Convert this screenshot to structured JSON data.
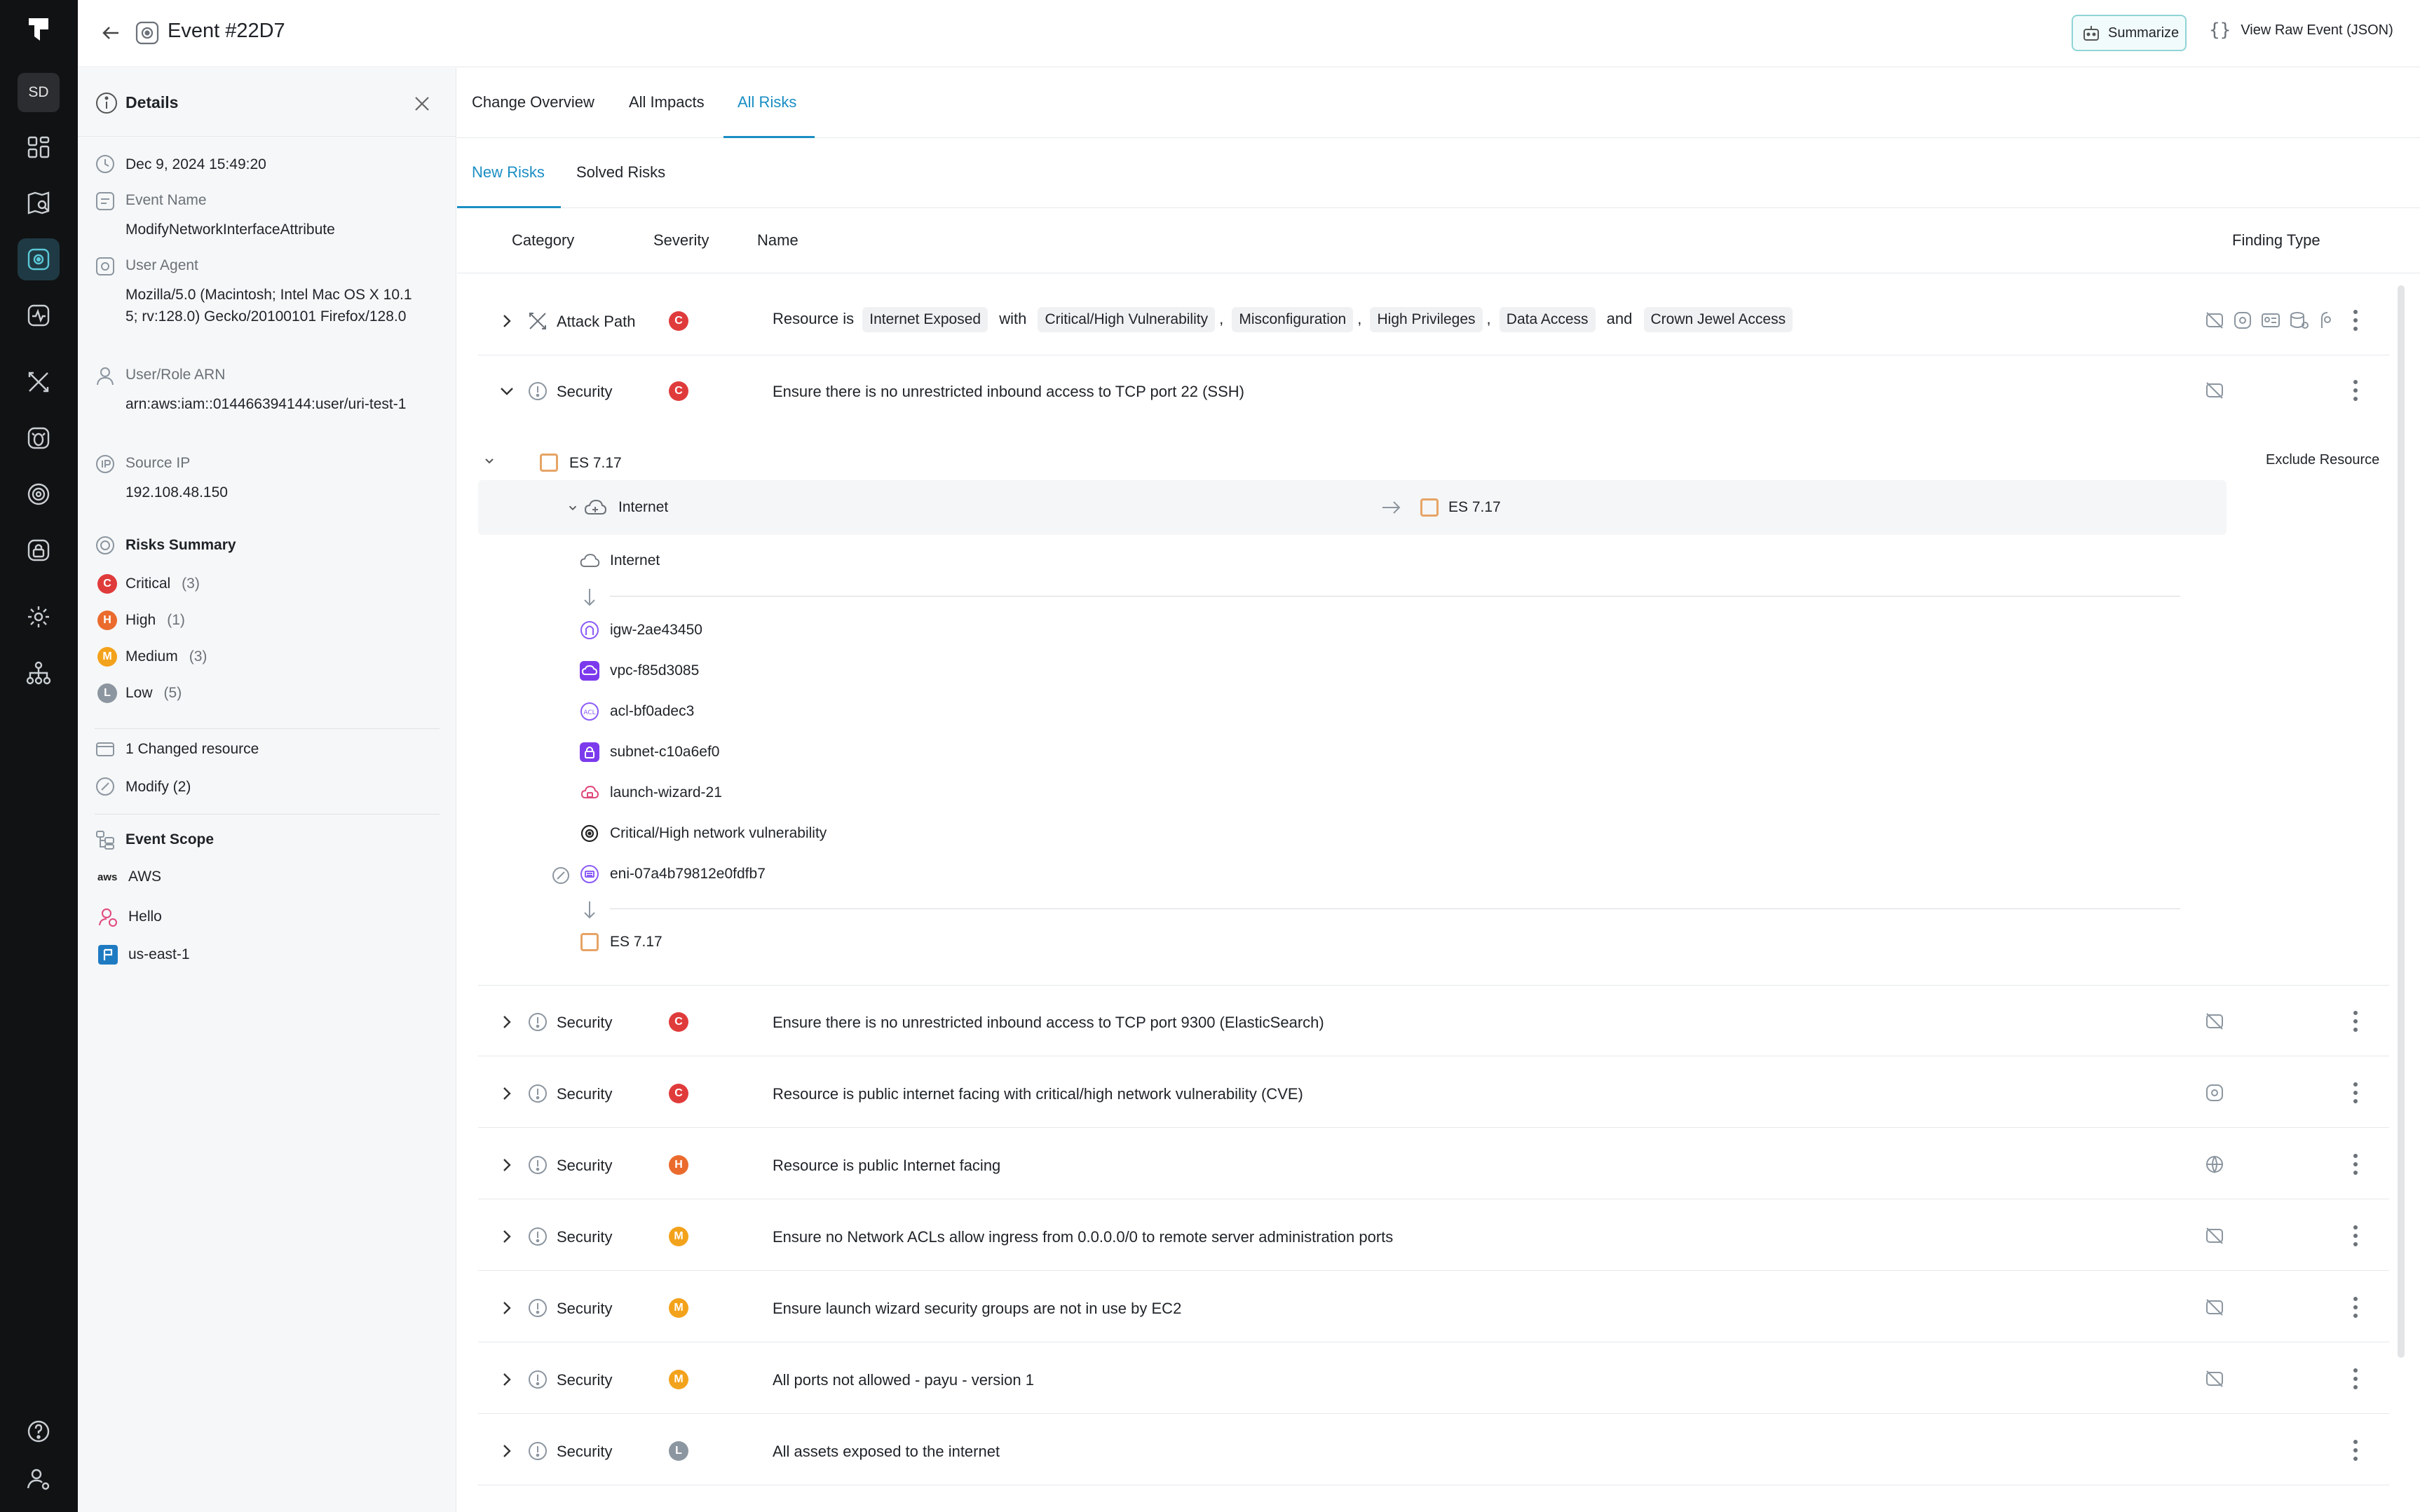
{
  "header": {
    "title": "Event #22D7",
    "summarize_label": "Summarize",
    "raw_label": "View Raw Event (JSON)"
  },
  "rail": {
    "avatar": "SD"
  },
  "details": {
    "title": "Details",
    "timestamp": "Dec 9, 2024 15:49:20",
    "event_name_label": "Event Name",
    "event_name": "ModifyNetworkInterfaceAttribute",
    "user_agent_label": "User Agent",
    "user_agent": "Mozilla/5.0 (Macintosh; Intel Mac OS X 10.15; rv:128.0) Gecko/20100101 Firefox/128.0",
    "arn_label": "User/Role ARN",
    "arn": "arn:aws:iam::014466394144:user/uri-test-1",
    "source_ip_label": "Source IP",
    "source_ip": "192.108.48.150",
    "risks_summary_label": "Risks Summary",
    "risks": [
      {
        "letter": "C",
        "label": "Critical",
        "count": "(3)",
        "color": "#e03b3b"
      },
      {
        "letter": "H",
        "label": "High",
        "count": "(1)",
        "color": "#ea6b2d"
      },
      {
        "letter": "M",
        "label": "Medium",
        "count": "(3)",
        "color": "#f3a21b"
      },
      {
        "letter": "L",
        "label": "Low",
        "count": "(5)",
        "color": "#8c96a0"
      }
    ],
    "changed_label": "1 Changed resource",
    "modify_label": "Modify (2)",
    "scope_label": "Event Scope",
    "scope": {
      "aws": "AWS",
      "aws_logo": "aws",
      "account": "Hello",
      "region": "us-east-1"
    }
  },
  "tabs": {
    "primary": [
      "Change Overview",
      "All Impacts",
      "All Risks"
    ],
    "primary_active": "All Risks",
    "secondary": [
      "New Risks",
      "Solved Risks"
    ],
    "secondary_active": "New Risks"
  },
  "table": {
    "columns": {
      "category": "Category",
      "severity": "Severity",
      "name": "Name",
      "finding": "Finding Type"
    },
    "attack_row": {
      "category": "Attack Path",
      "severity": "C",
      "prefix": "Resource is",
      "chip1": "Internet Exposed",
      "with": "with",
      "chip2": "Critical/High Vulnerability",
      "comma1": ",",
      "chip3": "Misconfiguration",
      "comma2": ",",
      "chip4": "High Privileges",
      "comma3": ",",
      "chip5": "Data Access",
      "and": "and",
      "chip6": "Crown Jewel Access"
    },
    "rows": [
      {
        "category": "Security",
        "severity": "C",
        "name": "Ensure there is no unrestricted inbound access to TCP port 22 (SSH)"
      },
      {
        "category": "Security",
        "severity": "C",
        "name": "Ensure there is no unrestricted inbound access to TCP port 9300 (ElasticSearch)"
      },
      {
        "category": "Security",
        "severity": "C",
        "name": "Resource is public internet facing with critical/high network vulnerability (CVE)"
      },
      {
        "category": "Security",
        "severity": "H",
        "name": "Resource is public Internet facing"
      },
      {
        "category": "Security",
        "severity": "M",
        "name": "Ensure no Network ACLs allow ingress from 0.0.0.0/0 to remote server administration ports"
      },
      {
        "category": "Security",
        "severity": "M",
        "name": "Ensure launch wizard security groups are not in use by EC2"
      },
      {
        "category": "Security",
        "severity": "M",
        "name": "All ports not allowed - payu - version 1"
      },
      {
        "category": "Security",
        "severity": "L",
        "name": "All assets exposed to the internet"
      }
    ],
    "expanded": {
      "resource": "ES 7.17",
      "exclude_label": "Exclude Resource",
      "path_source": "Internet",
      "path_target": "ES 7.17",
      "nodes": [
        {
          "label": "Internet"
        },
        {
          "label": "igw-2ae43450"
        },
        {
          "label": "vpc-f85d3085"
        },
        {
          "label": "acl-bf0adec3"
        },
        {
          "label": "subnet-c10a6ef0"
        },
        {
          "label": "launch-wizard-21"
        },
        {
          "label": "Critical/High network vulnerability"
        },
        {
          "label": "eni-07a4b79812e0fdfb7"
        },
        {
          "label": "ES 7.17"
        }
      ]
    }
  },
  "colors": {
    "accent": "#1a8ec4",
    "rail": "#111213",
    "critical": "#e03b3b",
    "high": "#ea6b2d",
    "medium": "#f3a21b",
    "low": "#8c96a0"
  }
}
